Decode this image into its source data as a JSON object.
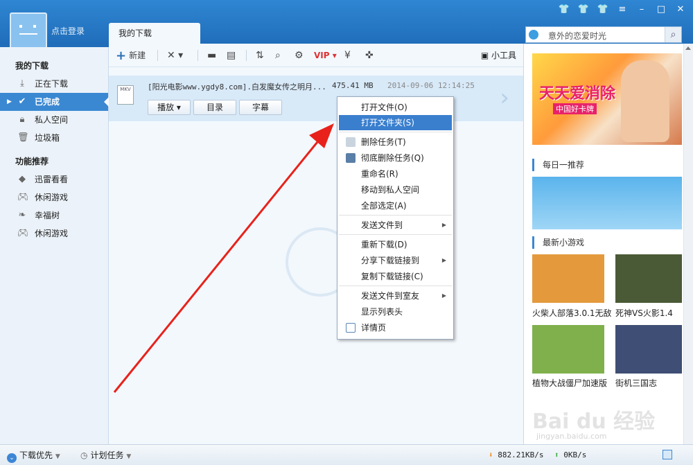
{
  "titlebar": {
    "login": "点击登录",
    "tab": "我的下载"
  },
  "search": {
    "placeholder": "意外的恋爱时光"
  },
  "sidebar": {
    "section1": "我的下载",
    "items1": [
      {
        "label": "正在下载",
        "icon": "download-icon"
      },
      {
        "label": "已完成",
        "icon": "check-icon"
      },
      {
        "label": "私人空间",
        "icon": "lock-icon"
      },
      {
        "label": "垃圾箱",
        "icon": "trash-icon"
      }
    ],
    "section2": "功能推荐",
    "items2": [
      {
        "label": "迅雷看看",
        "icon": "shield-icon"
      },
      {
        "label": "休闲游戏",
        "icon": "gamepad-icon"
      },
      {
        "label": "幸福树",
        "icon": "leaf-icon"
      },
      {
        "label": "休闲游戏",
        "icon": "gamepad-icon"
      }
    ]
  },
  "toolbar": {
    "new_label": "新建",
    "tools_label": "小工具"
  },
  "task": {
    "badge": "MKV",
    "name": "[阳光电影www.ygdy8.com].白发魔女传之明月...",
    "size": "475.41 MB",
    "time": "2014-09-06 12:14:25",
    "buttons": [
      "播放",
      "目录",
      "字幕"
    ]
  },
  "context_menu": {
    "items": [
      "打开文件(O)",
      "打开文件夹(S)",
      "删除任务(T)",
      "彻底删除任务(Q)",
      "重命名(R)",
      "移动到私人空间",
      "全部选定(A)",
      "发送文件到",
      "重新下载(D)",
      "分享下载链接到",
      "复制下载链接(C)",
      "发送文件到室友",
      "显示列表头",
      "详情页"
    ]
  },
  "right_panel": {
    "banner_logo": "天天爱消除",
    "banner_sub": "中国好卡牌",
    "sec_daily": "每日一推荐",
    "sec_games": "最新小游戏",
    "games": [
      "火柴人部落3.0.1无敌",
      "死神VS火影1.4",
      "植物大战僵尸加速版",
      "街机三国志"
    ],
    "watermark": "Bai du 经验",
    "watermark_url": "jingyan.baidu.com"
  },
  "status": {
    "priority": "下载优先",
    "schedule": "计划任务",
    "down_speed": "882.21KB/s",
    "up_speed": "0KB/s"
  },
  "colors": {
    "accent": "#3a88d2",
    "highlight": "#3a7fce",
    "arrow": "#e8221b"
  }
}
